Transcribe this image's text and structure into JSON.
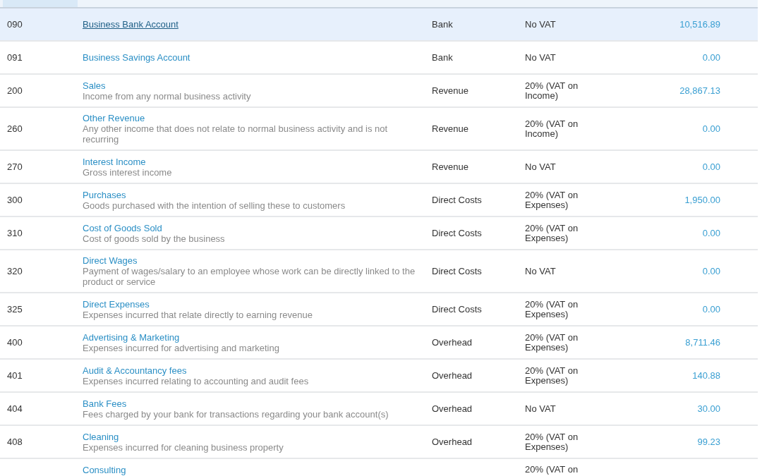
{
  "table": {
    "columns": [
      {
        "selected": true
      },
      {
        "selected": false
      },
      {
        "selected": false
      },
      {
        "selected": false
      },
      {
        "selected": false
      }
    ],
    "rows": [
      {
        "code": "090",
        "name": "Business Bank Account",
        "type": "Bank",
        "tax_rate": "No VAT",
        "ytd": "10,516.89",
        "selected": true
      },
      {
        "code": "091",
        "name": "Business Savings Account",
        "type": "Bank",
        "tax_rate": "No VAT",
        "ytd": "0.00",
        "selected": false
      },
      {
        "code": "200",
        "name": "Sales",
        "description": "Income from any normal business activity",
        "type": "Revenue",
        "tax_rate": "20% (VAT on Income)",
        "ytd": "28,867.13",
        "selected": false
      },
      {
        "code": "260",
        "name": "Other Revenue",
        "description": "Any other income that does not relate to normal business activity and is not recurring",
        "type": "Revenue",
        "tax_rate": "20% (VAT on Income)",
        "ytd": "0.00",
        "selected": false
      },
      {
        "code": "270",
        "name": "Interest Income",
        "description": "Gross interest income",
        "type": "Revenue",
        "tax_rate": "No VAT",
        "ytd": "0.00",
        "selected": false
      },
      {
        "code": "300",
        "name": "Purchases",
        "description": "Goods purchased with the intention of selling these to customers",
        "type": "Direct Costs",
        "tax_rate": "20% (VAT on Expenses)",
        "ytd": "1,950.00",
        "selected": false
      },
      {
        "code": "310",
        "name": "Cost of Goods Sold",
        "description": "Cost of goods sold by the business",
        "type": "Direct Costs",
        "tax_rate": "20% (VAT on Expenses)",
        "ytd": "0.00",
        "selected": false
      },
      {
        "code": "320",
        "name": "Direct Wages",
        "description": "Payment of wages/salary to an employee whose work can be directly linked to the product or service",
        "type": "Direct Costs",
        "tax_rate": "No VAT",
        "ytd": "0.00",
        "selected": false
      },
      {
        "code": "325",
        "name": "Direct Expenses",
        "description": "Expenses incurred that relate directly to earning revenue",
        "type": "Direct Costs",
        "tax_rate": "20% (VAT on Expenses)",
        "ytd": "0.00",
        "selected": false
      },
      {
        "code": "400",
        "name": "Advertising & Marketing",
        "description": "Expenses incurred for advertising and marketing",
        "type": "Overhead",
        "tax_rate": "20% (VAT on Expenses)",
        "ytd": "8,711.46",
        "selected": false
      },
      {
        "code": "401",
        "name": "Audit & Accountancy fees",
        "description": "Expenses incurred relating to accounting and audit fees",
        "type": "Overhead",
        "tax_rate": "20% (VAT on Expenses)",
        "ytd": "140.88",
        "selected": false
      },
      {
        "code": "404",
        "name": "Bank Fees",
        "description": "Fees charged by your bank for transactions regarding your bank account(s)",
        "type": "Overhead",
        "tax_rate": "No VAT",
        "ytd": "30.00",
        "selected": false
      },
      {
        "code": "408",
        "name": "Cleaning",
        "description": "Expenses incurred for cleaning business property",
        "type": "Overhead",
        "tax_rate": "20% (VAT on Expenses)",
        "ytd": "99.23",
        "selected": false
      },
      {
        "name": "Consulting",
        "tax_rate": "20% (VAT on",
        "selected": false
      }
    ]
  }
}
